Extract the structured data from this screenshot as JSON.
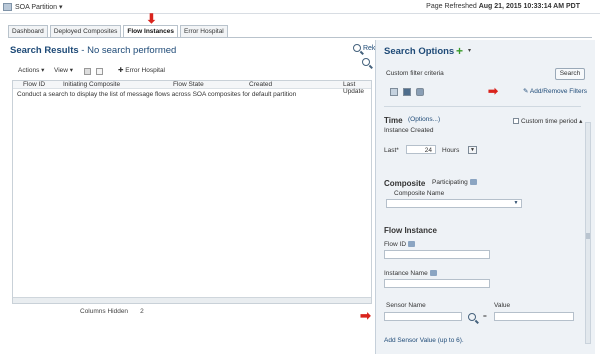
{
  "topbar": {
    "title": "SOA Partition",
    "refresh_label": "Page Refreshed",
    "refresh_time": "Aug 21, 2015 10:33:14 AM PDT"
  },
  "tabs": [
    "Dashboard",
    "Deployed Composites",
    "Flow Instances",
    "Error Hospital"
  ],
  "results": {
    "title": "Search Results",
    "subtitle": "- No search performed",
    "search_link": "Reki",
    "toolbar": {
      "actions": "Actions",
      "view": "View",
      "error_hospital": "Error Hospital"
    },
    "columns": [
      "Flow ID",
      "Initiating Composite",
      "Flow State",
      "Created",
      "Last Update"
    ],
    "message": "Conduct a search to display the list of message flows across SOA composites for default partition",
    "status_label": "Columns Hidden",
    "status_value": "2"
  },
  "search_options": {
    "title": "Search Options",
    "custom_filter": "Custom filter criteria",
    "search_button": "Search",
    "add_remove_filters": "Add/Remove Filters",
    "time": {
      "title": "Time",
      "options_link": "(Options...)",
      "custom_time_period": "Custom time period",
      "instance_created": "Instance Created",
      "last_label": "Last*",
      "last_value": "24",
      "unit": "Hours"
    },
    "composite": {
      "title": "Composite",
      "participating": "Participating",
      "composite_name": "Composite Name"
    },
    "flow_instance": {
      "title": "Flow Instance",
      "flow_id": "Flow ID",
      "instance_name": "Instance Name",
      "sensor_name": "Sensor Name",
      "value": "Value",
      "equals": "=",
      "add_sensor": "Add Sensor Value (up to 6)."
    }
  }
}
